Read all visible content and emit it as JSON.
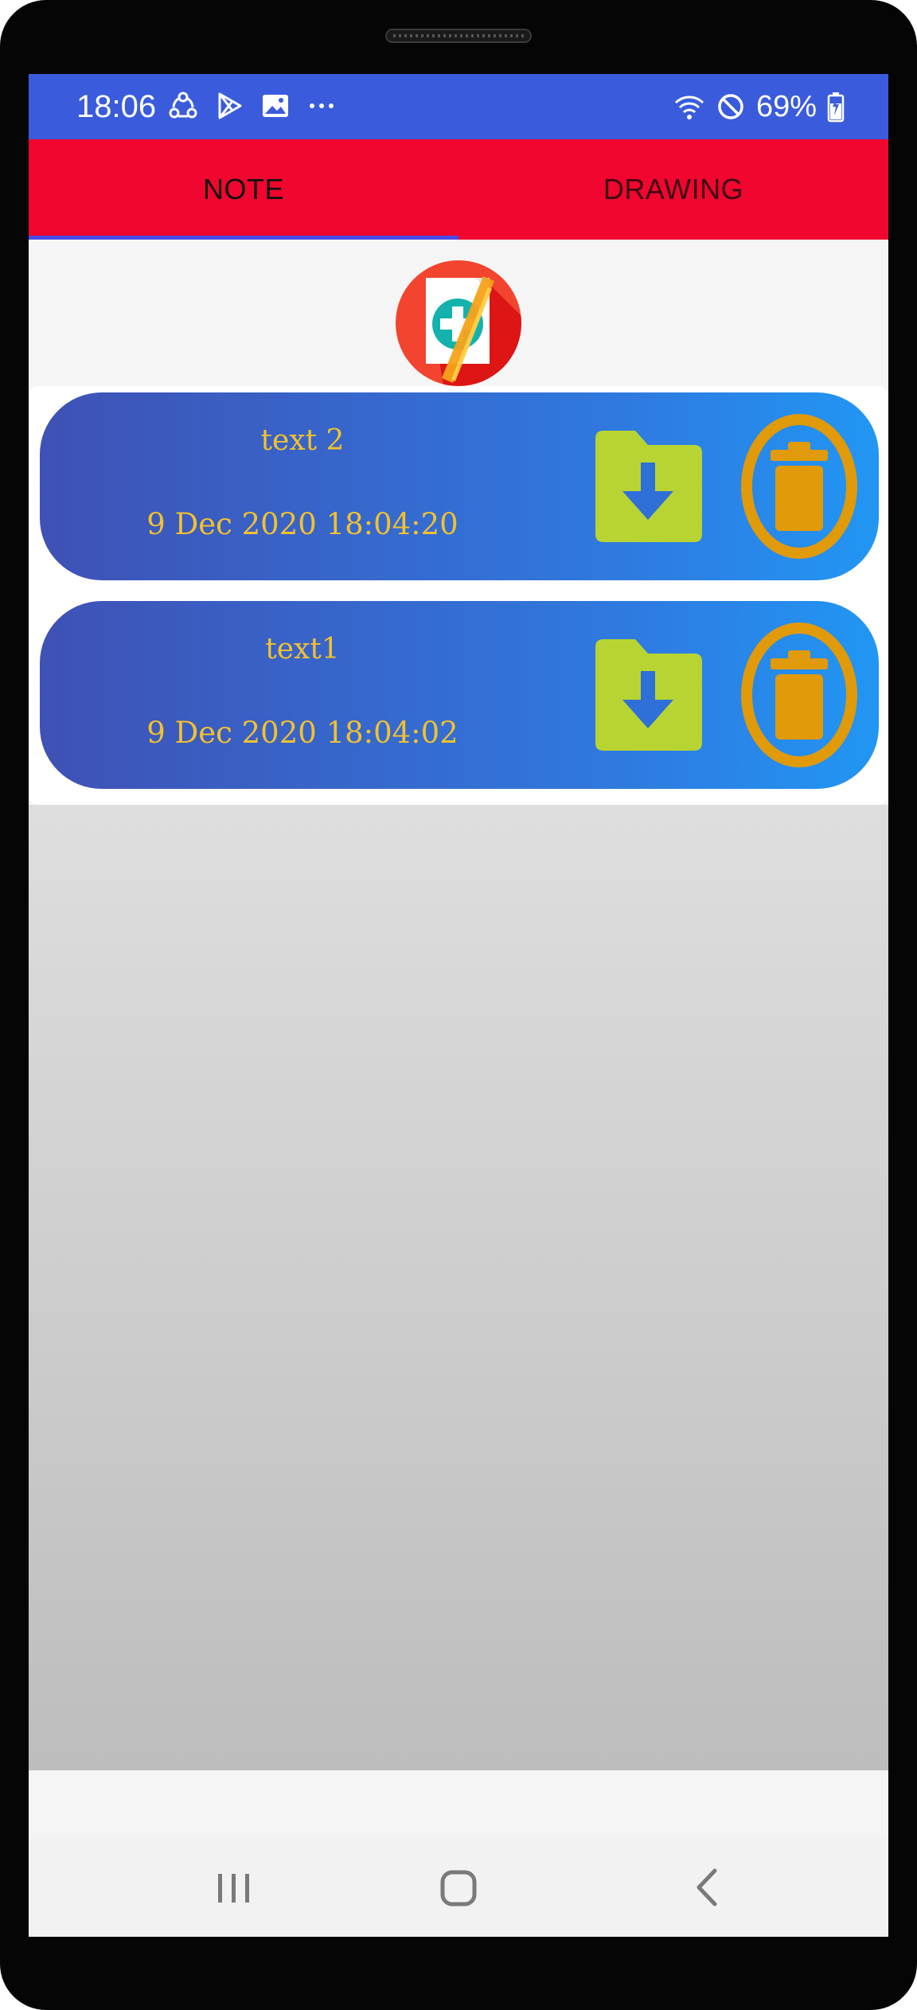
{
  "status_bar": {
    "time": "18:06",
    "battery": "69%",
    "icons": [
      "share-icon",
      "play-store-icon",
      "gallery-icon",
      "more-dots-icon",
      "wifi-icon",
      "do-not-disturb-icon",
      "battery-charging-icon"
    ]
  },
  "tabs": [
    {
      "label": "NOTE",
      "selected": true
    },
    {
      "label": "DRAWING",
      "selected": false
    }
  ],
  "add_button": {
    "icon": "add-note-icon"
  },
  "notes": [
    {
      "title": "text 2",
      "date": "9 Dec 2020 18:04:20"
    },
    {
      "title": "text1",
      "date": "9 Dec 2020 18:04:02"
    }
  ],
  "colors": {
    "status_bar": "#3a5bdc",
    "tab_bar": "#f0062e",
    "tab_indicator": "#4a4ae6",
    "item_gradient_start": "#3f51b5",
    "item_gradient_end": "#2196f3",
    "note_text": "#f2c12e",
    "save_icon": "#b8d432",
    "delete_icon": "#e09a0a"
  },
  "nav_bar": {
    "icons": [
      "recents-icon",
      "home-icon",
      "back-icon"
    ]
  }
}
